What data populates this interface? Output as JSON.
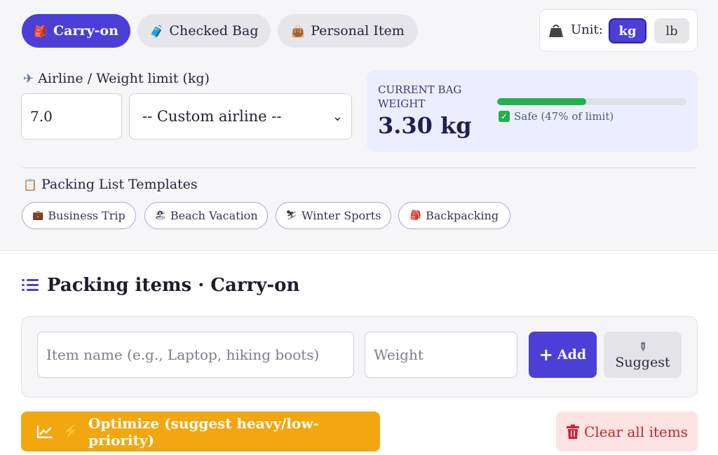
{
  "bag_tabs": [
    {
      "label": "Carry-on",
      "icon": "🎒",
      "active": true
    },
    {
      "label": "Checked Bag",
      "icon": "🧳",
      "active": false
    },
    {
      "label": "Personal Item",
      "icon": "👜",
      "active": false
    }
  ],
  "unit": {
    "label": "Unit:",
    "options": [
      "kg",
      "lb"
    ],
    "selected": "kg"
  },
  "airline": {
    "label": "Airline / Weight limit (kg)",
    "limit_value": "7.0",
    "selected_airline": "-- Custom airline --"
  },
  "current_weight": {
    "title": "CURRENT BAG WEIGHT",
    "value": "3.30 kg",
    "percent_of_limit": 47,
    "status": "Safe (47% of limit)",
    "bar_color": "#21b24a"
  },
  "templates": {
    "label": "Packing List Templates",
    "items": [
      {
        "label": "Business Trip",
        "icon": "💼"
      },
      {
        "label": "Beach Vacation",
        "icon": "🏖"
      },
      {
        "label": "Winter Sports",
        "icon": "⛷"
      },
      {
        "label": "Backpacking",
        "icon": "🎒"
      }
    ]
  },
  "packing": {
    "title": "Packing items",
    "bag_name": "· Carry-on",
    "item_placeholder": "Item name (e.g., Laptop, hiking boots)",
    "weight_placeholder": "Weight",
    "add_label": "Add",
    "suggest_label": "Suggest",
    "optimize_label": "Optimize (suggest heavy/low-priority)",
    "clear_label": "Clear all items"
  },
  "colors": {
    "accent": "#4b3fd8",
    "warning": "#f2a60f",
    "danger": "#c8242a",
    "safe": "#21b24a"
  }
}
